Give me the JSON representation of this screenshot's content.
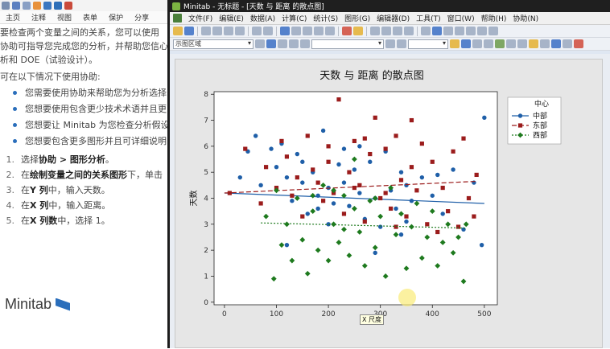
{
  "help": {
    "ribbon_tabs": [
      "主页",
      "注释",
      "视图",
      "表单",
      "保护",
      "分享"
    ],
    "intro_lines": [
      "要检查两个变量之间的关系，您可以使用",
      "协助可指导您完成您的分析，并帮助您信心",
      "析和 DOE（试验设计）。"
    ],
    "subheading": "可在以下情况下使用协助:",
    "bullets": [
      "您需要使用协助来帮助您为分析选择",
      "您想要使用包含更少技术术语并且更",
      "您想要让 Minitab 为您检查分析假设。",
      "您想要包含更多图形并且可详细说明"
    ],
    "steps": [
      {
        "num": "1.",
        "parts": [
          [
            "选择",
            false
          ],
          [
            "协助 > 图形分析",
            true
          ],
          [
            "。",
            false
          ]
        ]
      },
      {
        "num": "2.",
        "parts": [
          [
            "在",
            false
          ],
          [
            "绘制变量之间的关系图形",
            true
          ],
          [
            "下，单击",
            false
          ]
        ]
      },
      {
        "num": "3.",
        "parts": [
          [
            "在",
            false
          ],
          [
            "Y 列",
            true
          ],
          [
            "中，输入天数。",
            false
          ]
        ]
      },
      {
        "num": "4.",
        "parts": [
          [
            "在",
            false
          ],
          [
            "X 列",
            true
          ],
          [
            "中，输入距离。",
            false
          ]
        ]
      },
      {
        "num": "5.",
        "parts": [
          [
            "在",
            false
          ],
          [
            "X 列数",
            true
          ],
          [
            "中，选择 1。",
            false
          ]
        ]
      }
    ],
    "logo_text": "Minitab"
  },
  "window": {
    "title": "Minitab - 无标题 - [天数 与 距离 的散点图]",
    "menu": [
      "文件(F)",
      "编辑(E)",
      "数据(A)",
      "计算(C)",
      "统计(S)",
      "图形(G)",
      "编辑器(D)",
      "工具(T)",
      "窗口(W)",
      "帮助(H)",
      "协助(N)"
    ],
    "region_combo": "示图区域"
  },
  "tooltip": "X 尺度",
  "colors": {
    "center": "#1f5fa8",
    "east": "#9b1c1c",
    "west": "#1e7a1e"
  },
  "chart_data": {
    "type": "scatter",
    "title": "天数 与 距离 的散点图",
    "xlabel": "",
    "ylabel": "天数",
    "xlim": [
      -20,
      525
    ],
    "ylim": [
      -0.1,
      8.1
    ],
    "xticks": [
      0,
      100,
      200,
      300,
      400,
      500
    ],
    "yticks": [
      0,
      1,
      2,
      3,
      4,
      5,
      6,
      7,
      8
    ],
    "legend": {
      "title": "中心",
      "placement": "right"
    },
    "series": [
      {
        "name": "中部",
        "marker": "circle",
        "color": "#1f5fa8",
        "line": [
          [
            0,
            4.2
          ],
          [
            500,
            3.8
          ]
        ],
        "points": [
          [
            30,
            4.8
          ],
          [
            45,
            5.8
          ],
          [
            60,
            6.4
          ],
          [
            70,
            4.5
          ],
          [
            90,
            5.9
          ],
          [
            100,
            5.2
          ],
          [
            110,
            6.1
          ],
          [
            120,
            4.8
          ],
          [
            130,
            3.9
          ],
          [
            140,
            5.7
          ],
          [
            150,
            4.6
          ],
          [
            160,
            3.4
          ],
          [
            170,
            5.0
          ],
          [
            180,
            4.1
          ],
          [
            190,
            6.6
          ],
          [
            200,
            4.4
          ],
          [
            210,
            3.8
          ],
          [
            220,
            5.3
          ],
          [
            230,
            4.6
          ],
          [
            240,
            3.7
          ],
          [
            250,
            5.1
          ],
          [
            260,
            4.2
          ],
          [
            270,
            3.2
          ],
          [
            280,
            5.4
          ],
          [
            290,
            4.0
          ],
          [
            300,
            2.9
          ],
          [
            310,
            5.8
          ],
          [
            320,
            4.3
          ],
          [
            330,
            3.6
          ],
          [
            340,
            5.0
          ],
          [
            350,
            4.5
          ],
          [
            360,
            3.9
          ],
          [
            380,
            4.8
          ],
          [
            400,
            4.1
          ],
          [
            420,
            3.4
          ],
          [
            440,
            5.1
          ],
          [
            460,
            2.8
          ],
          [
            480,
            4.6
          ],
          [
            495,
            2.2
          ],
          [
            500,
            7.1
          ],
          [
            150,
            5.4
          ],
          [
            260,
            6.0
          ],
          [
            200,
            3.0
          ],
          [
            340,
            2.6
          ],
          [
            120,
            2.2
          ],
          [
            230,
            5.9
          ],
          [
            410,
            4.9
          ],
          [
            290,
            1.9
          ],
          [
            180,
            3.6
          ],
          [
            350,
            3.1
          ]
        ]
      },
      {
        "name": "东部",
        "marker": "square",
        "color": "#9b1c1c",
        "line": [
          [
            0,
            4.2
          ],
          [
            485,
            4.65
          ]
        ],
        "points": [
          [
            10,
            4.2
          ],
          [
            40,
            5.9
          ],
          [
            70,
            3.8
          ],
          [
            80,
            5.2
          ],
          [
            100,
            4.4
          ],
          [
            120,
            5.6
          ],
          [
            140,
            4.8
          ],
          [
            150,
            3.3
          ],
          [
            160,
            6.4
          ],
          [
            170,
            5.1
          ],
          [
            180,
            4.6
          ],
          [
            190,
            3.9
          ],
          [
            200,
            5.4
          ],
          [
            210,
            4.2
          ],
          [
            220,
            7.8
          ],
          [
            230,
            3.4
          ],
          [
            240,
            5.0
          ],
          [
            250,
            6.2
          ],
          [
            260,
            4.5
          ],
          [
            270,
            3.1
          ],
          [
            280,
            5.7
          ],
          [
            290,
            7.1
          ],
          [
            300,
            4.0
          ],
          [
            310,
            5.9
          ],
          [
            320,
            3.6
          ],
          [
            330,
            6.4
          ],
          [
            340,
            4.7
          ],
          [
            350,
            3.3
          ],
          [
            360,
            5.2
          ],
          [
            370,
            4.3
          ],
          [
            380,
            6.1
          ],
          [
            390,
            3.0
          ],
          [
            400,
            5.4
          ],
          [
            410,
            2.7
          ],
          [
            420,
            4.4
          ],
          [
            430,
            3.5
          ],
          [
            440,
            5.8
          ],
          [
            450,
            2.9
          ],
          [
            460,
            6.3
          ],
          [
            470,
            4.0
          ],
          [
            480,
            3.3
          ],
          [
            485,
            4.9
          ],
          [
            130,
            4.1
          ],
          [
            250,
            4.4
          ],
          [
            310,
            4.2
          ],
          [
            360,
            7.0
          ],
          [
            200,
            6.0
          ],
          [
            110,
            6.2
          ],
          [
            330,
            2.9
          ],
          [
            270,
            6.3
          ]
        ]
      },
      {
        "name": "西部",
        "marker": "diamond",
        "color": "#1e7a1e",
        "line": [
          [
            70,
            3.05
          ],
          [
            465,
            2.85
          ]
        ],
        "points": [
          [
            80,
            3.3
          ],
          [
            95,
            0.9
          ],
          [
            100,
            4.3
          ],
          [
            110,
            2.2
          ],
          [
            120,
            3.0
          ],
          [
            130,
            1.6
          ],
          [
            140,
            4.0
          ],
          [
            150,
            2.4
          ],
          [
            160,
            1.1
          ],
          [
            170,
            3.5
          ],
          [
            180,
            2.0
          ],
          [
            190,
            4.5
          ],
          [
            200,
            1.6
          ],
          [
            210,
            3.0
          ],
          [
            220,
            2.3
          ],
          [
            230,
            4.1
          ],
          [
            240,
            1.8
          ],
          [
            250,
            3.6
          ],
          [
            260,
            2.7
          ],
          [
            270,
            1.4
          ],
          [
            280,
            3.9
          ],
          [
            290,
            2.1
          ],
          [
            300,
            3.3
          ],
          [
            310,
            1.0
          ],
          [
            320,
            4.4
          ],
          [
            330,
            2.6
          ],
          [
            340,
            3.4
          ],
          [
            350,
            1.3
          ],
          [
            360,
            2.9
          ],
          [
            370,
            3.8
          ],
          [
            380,
            1.7
          ],
          [
            390,
            2.5
          ],
          [
            400,
            3.5
          ],
          [
            410,
            1.4
          ],
          [
            420,
            2.3
          ],
          [
            430,
            3.0
          ],
          [
            440,
            1.9
          ],
          [
            450,
            2.5
          ],
          [
            460,
            0.8
          ],
          [
            465,
            3.0
          ],
          [
            210,
            4.3
          ],
          [
            250,
            5.5
          ],
          [
            170,
            4.1
          ],
          [
            290,
            4.0
          ],
          [
            230,
            2.8
          ]
        ]
      }
    ]
  }
}
